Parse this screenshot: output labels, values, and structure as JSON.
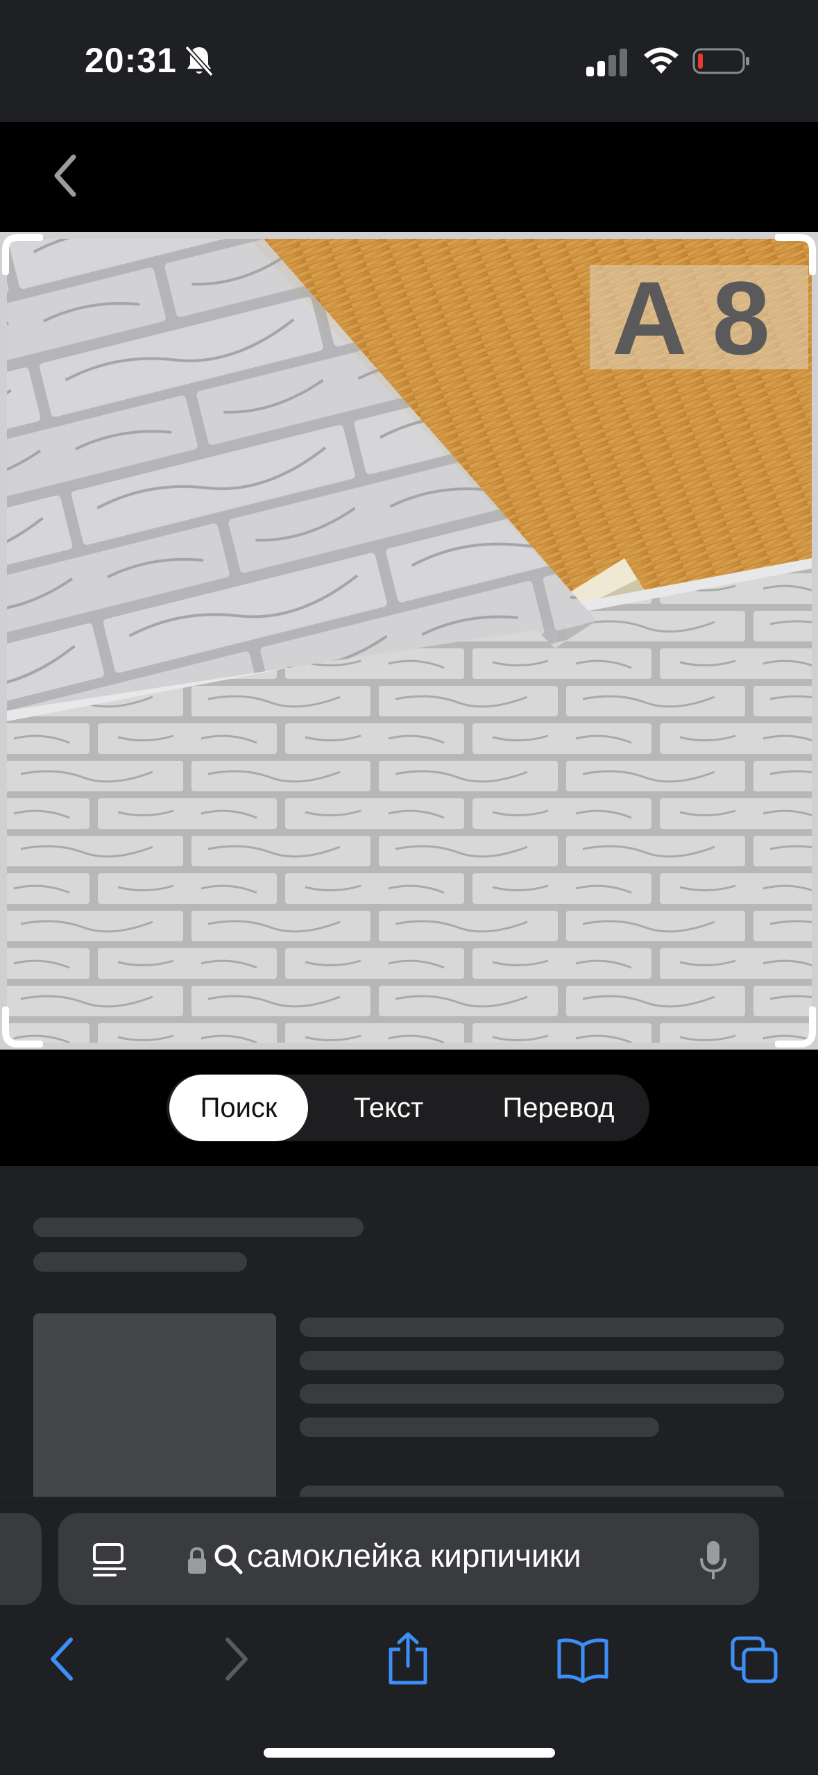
{
  "status_bar": {
    "time": "20:31",
    "icons": [
      "bell-slash-icon",
      "cellular-signal-icon",
      "wifi-icon",
      "battery-low-icon"
    ],
    "battery_color": "#e63b2e"
  },
  "nav": {
    "back_icon": "chevron-left-icon"
  },
  "image": {
    "overlay_text": "A 8",
    "description_icon": "brick-wall-photo"
  },
  "mode_tabs": {
    "items": [
      {
        "label": "Поиск",
        "selected": true
      },
      {
        "label": "Текст",
        "selected": false
      },
      {
        "label": "Перевод",
        "selected": false
      }
    ]
  },
  "address_bar": {
    "reader_icon": "reader-mode-icon",
    "lock_icon": "lock-icon",
    "search_icon": "search-icon",
    "text": "самоклейка кирпичики",
    "mic_icon": "microphone-icon"
  },
  "toolbar": {
    "items": [
      "back-icon",
      "forward-icon",
      "share-icon",
      "bookmarks-icon",
      "tabs-icon"
    ],
    "accent": "#3d8ef7",
    "disabled": "#5a5b60"
  }
}
